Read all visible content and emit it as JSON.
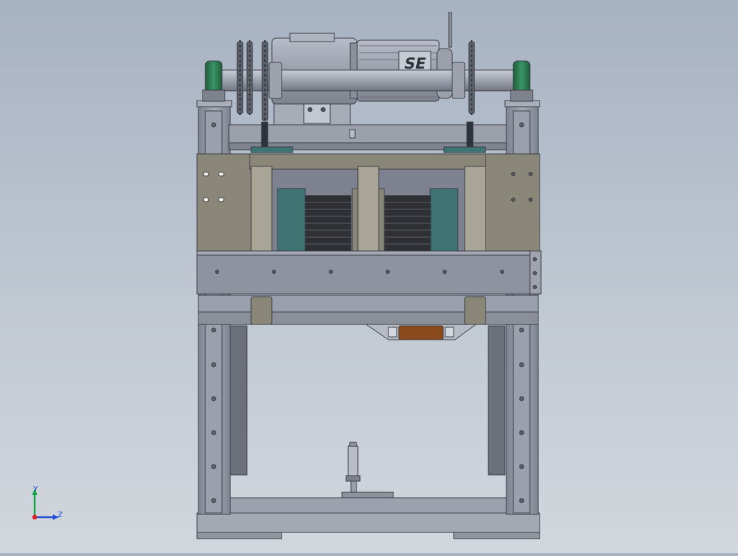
{
  "viewport": {
    "background_top": "#a7b2c2",
    "background_bottom": "#d2d7dd"
  },
  "model": {
    "motor_logo": "SE"
  },
  "axis_triad": {
    "y_label": "Y",
    "z_label": "Z",
    "y_color": "#16a34a",
    "z_color": "#1d4ed8",
    "origin_color": "#dc2626"
  },
  "colors": {
    "frame": "#9096a4",
    "frame_dark": "#70757f",
    "plate": "#8b8778",
    "teal": "#3f7474",
    "green": "#2f7d52",
    "brown": "#8a4a1e",
    "outline": "#3a3d44"
  }
}
